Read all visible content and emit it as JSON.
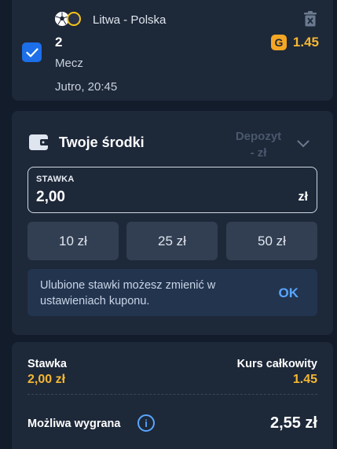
{
  "bet": {
    "event": "Litwa - Polska",
    "pick": "2",
    "market": "Mecz",
    "time": "Jutro, 20:45",
    "odds": "1.45",
    "boost_letter": "G"
  },
  "funds": {
    "title": "Twoje środki",
    "deposit_line1": "Depozyt",
    "deposit_line2": "- zł",
    "stake_label": "STAWKA",
    "stake_value": "2,00",
    "currency": "zł",
    "quick_stakes": [
      "10 zł",
      "25 zł",
      "50 zł"
    ],
    "info_text": "Ulubione stawki możesz zmienić w ustawieniach kuponu.",
    "info_ok": "OK"
  },
  "summary": {
    "stake_label": "Stawka",
    "stake_value": "2,00 zł",
    "total_odds_label": "Kurs całkowity",
    "total_odds_value": "1.45",
    "win_label": "Możliwa wygrana",
    "win_value": "2,55 zł"
  },
  "colors": {
    "accent": "#1c6fe8",
    "odds": "#f5b731",
    "link": "#58a6ff",
    "background": "#131c2b",
    "card": "#1d2839"
  },
  "icons": [
    "soccer-ball-icon",
    "team-crest-icon",
    "trash-icon",
    "checkmark-icon",
    "boost-icon",
    "wallet-icon",
    "chevron-down-icon",
    "info-icon"
  ]
}
